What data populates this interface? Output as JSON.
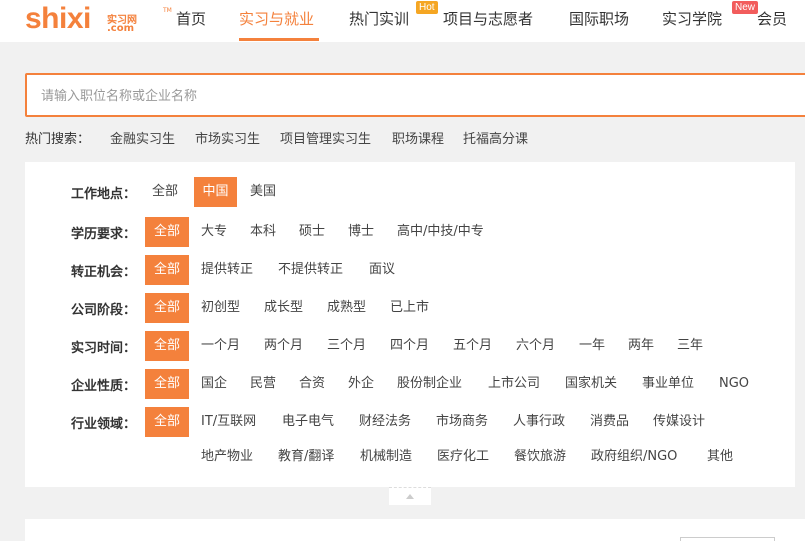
{
  "logo": {
    "main": "shixi",
    "cn": "实习网",
    "com": ".com",
    "tm": "TM"
  },
  "nav": {
    "items": [
      {
        "label": "首页"
      },
      {
        "label": "实习与就业"
      },
      {
        "label": "热门实训"
      },
      {
        "label": "项目与志愿者"
      },
      {
        "label": "国际职场"
      },
      {
        "label": "实习学院"
      },
      {
        "label": "会员"
      }
    ],
    "hot_badge": "Hot",
    "new_badge": "New"
  },
  "search": {
    "placeholder": "请输入职位名称或企业名称",
    "value": ""
  },
  "hot_search": {
    "label": "热门搜索：",
    "links": [
      "金融实习生",
      "市场实习生",
      "项目管理实习生",
      "职场课程",
      "托福高分课"
    ]
  },
  "filters": {
    "location": {
      "label": "工作地点：",
      "options": [
        "全部",
        "中国",
        "美国"
      ],
      "selected": "中国"
    },
    "education": {
      "label": "学历要求：",
      "options": [
        "全部",
        "大专",
        "本科",
        "硕士",
        "博士",
        "高中/中技/中专"
      ],
      "selected": "全部"
    },
    "fulltime": {
      "label": "转正机会：",
      "options": [
        "全部",
        "提供转正",
        "不提供转正",
        "面议"
      ],
      "selected": "全部"
    },
    "stage": {
      "label": "公司阶段：",
      "options": [
        "全部",
        "初创型",
        "成长型",
        "成熟型",
        "已上市"
      ],
      "selected": "全部"
    },
    "duration": {
      "label": "实习时间：",
      "options": [
        "全部",
        "一个月",
        "两个月",
        "三个月",
        "四个月",
        "五个月",
        "六个月",
        "一年",
        "两年",
        "三年"
      ],
      "selected": "全部"
    },
    "company_type": {
      "label": "企业性质：",
      "options": [
        "全部",
        "国企",
        "民营",
        "合资",
        "外企",
        "股份制企业",
        "上市公司",
        "国家机关",
        "事业单位",
        "NGO"
      ],
      "selected": "全部"
    },
    "industry": {
      "label": "行业领域：",
      "options": [
        "全部",
        "IT/互联网",
        "电子电气",
        "财经法务",
        "市场商务",
        "人事行政",
        "消费品",
        "传媒设计"
      ],
      "options_row2": [
        "地产物业",
        "教育/翻译",
        "机械制造",
        "医疗化工",
        "餐饮旅游",
        "政府组织/NGO",
        "其他"
      ],
      "selected": "全部"
    }
  },
  "bottom": {
    "text": "...",
    "accent": "#f4813c"
  },
  "colors": {
    "accent": "#f4813c",
    "hot": "#f5a623",
    "new": "#f25c5c"
  }
}
